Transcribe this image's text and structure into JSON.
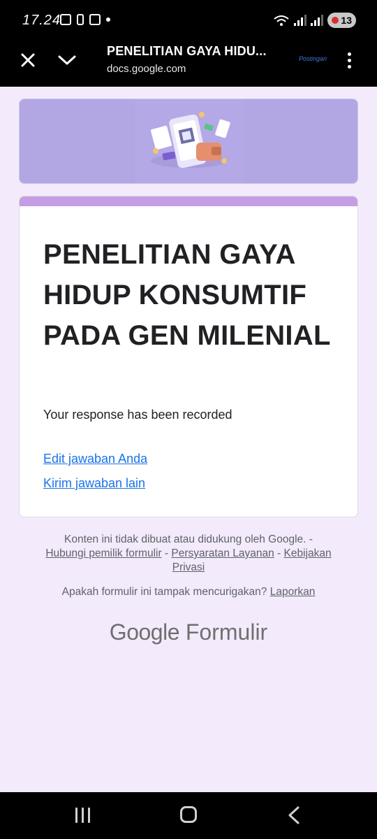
{
  "status_bar": {
    "time": "17.24",
    "battery": "13"
  },
  "toolbar": {
    "title": "PENELITIAN GAYA HIDU...",
    "url": "docs.google.com",
    "watermark": "Postingan"
  },
  "form": {
    "title": "PENELITIAN GAYA HIDUP KONSUMTIF PADA GEN MILENIAL",
    "response_message": "Your response has been recorded",
    "edit_link": "Edit jawaban Anda",
    "another_link": "Kirim jawaban lain"
  },
  "footer": {
    "disclaimer": "Konten ini tidak dibuat atau didukung oleh Google. -",
    "contact_owner": "Hubungi pemilik formulir",
    "separator": " - ",
    "terms": "Persyaratan Layanan",
    "privacy": "Kebijakan Privasi",
    "suspicious_question": "Apakah formulir ini tampak mencurigakan?",
    "report": "Laporkan",
    "brand_google": "Google",
    "brand_forms": "Formulir"
  },
  "colors": {
    "accent": "#c59de4",
    "link": "#1a73e8",
    "page_bg": "#f3eafb",
    "banner": "#b2a7e3"
  }
}
